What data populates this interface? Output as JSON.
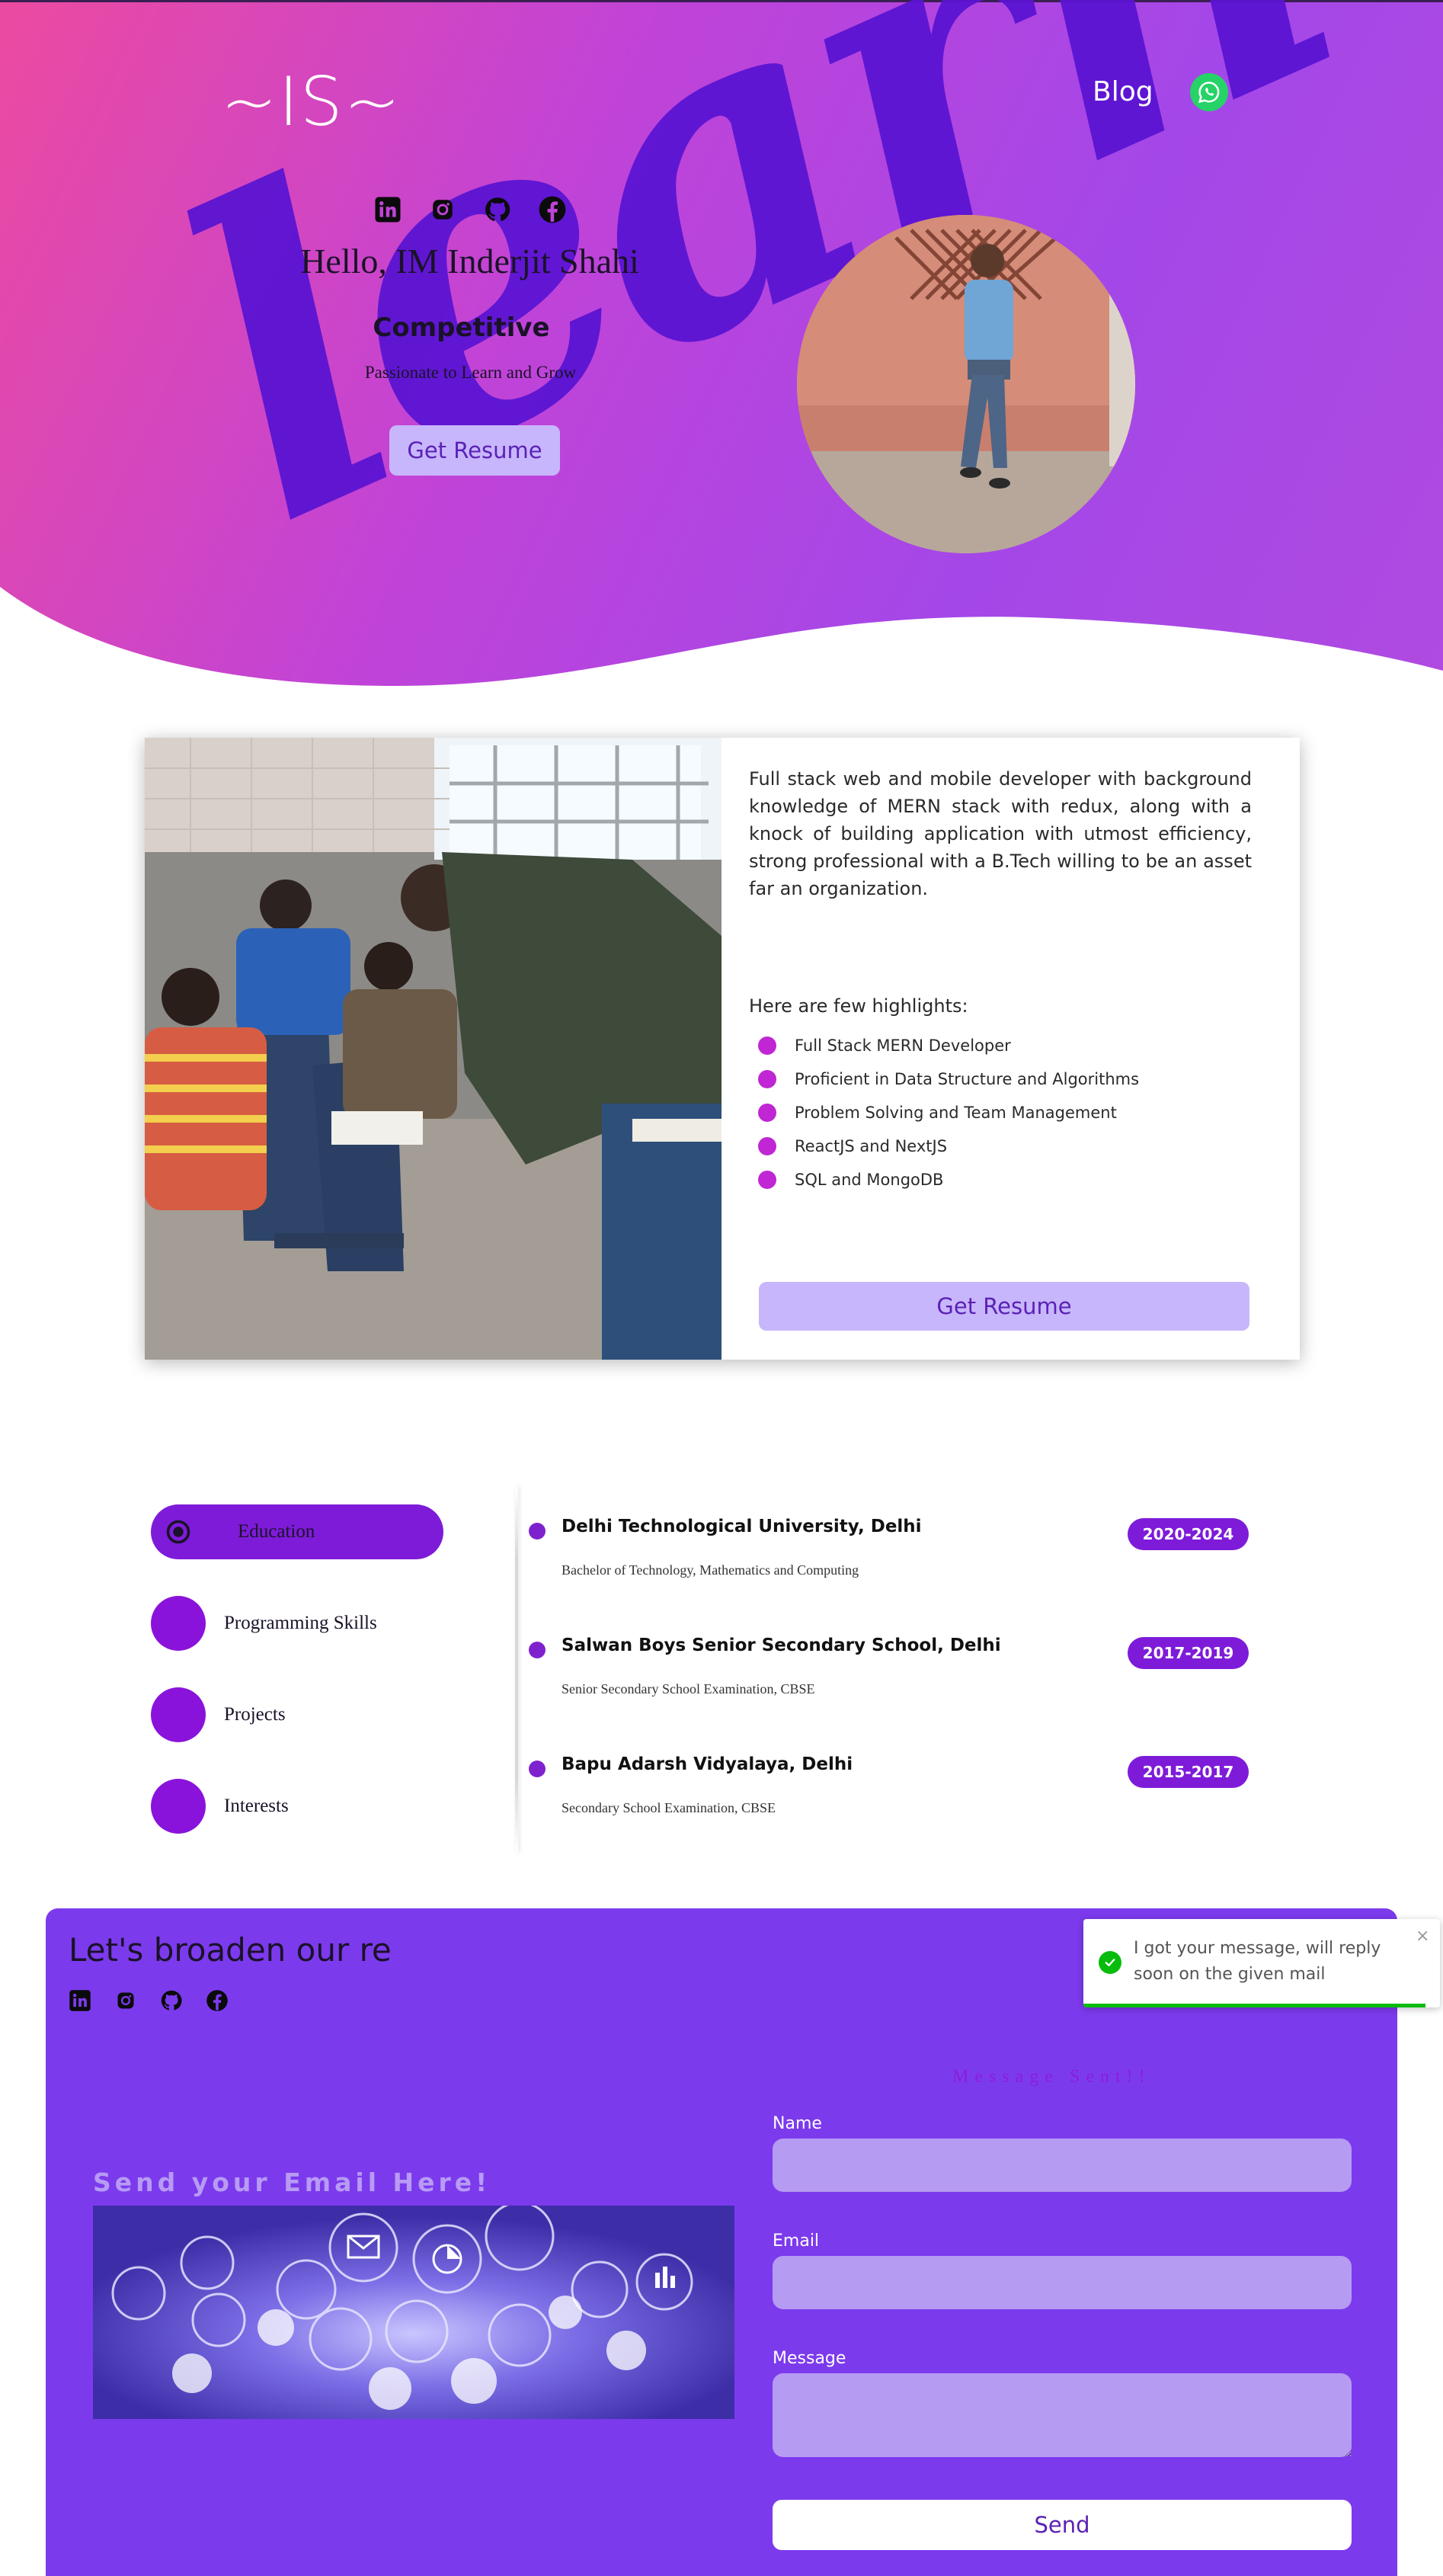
{
  "header": {
    "logo": "~IS~",
    "nav_blog": "Blog",
    "whatsapp_icon": "whatsapp-icon"
  },
  "hero": {
    "social_icons": [
      "linkedin-icon",
      "instagram-icon",
      "github-icon",
      "facebook-icon"
    ],
    "greeting": "Hello, IM Inderjit Shahi",
    "role": "Competitive",
    "tagline": "Passionate to Learn and Grow",
    "resume_button": "Get Resume"
  },
  "about": {
    "description": "Full stack web and mobile developer with background knowledge of MERN stack with redux, along with a knock of building application with utmost efficiency, strong professional with a B.Tech willing to be an asset far an organization.",
    "highlights_title": "Here are few highlights:",
    "highlights": [
      "Full Stack MERN Developer",
      "Proficient in Data Structure and Algorithms",
      "Problem Solving and Team Management",
      "ReactJS and NextJS",
      "SQL and MongoDB"
    ],
    "resume_button": "Get Resume"
  },
  "tabs": [
    {
      "label": "Education",
      "active": true
    },
    {
      "label": "Programming Skills",
      "active": false
    },
    {
      "label": "Projects",
      "active": false
    },
    {
      "label": "Interests",
      "active": false
    }
  ],
  "education": [
    {
      "title": "Delhi Technological University, Delhi",
      "subtitle": "Bachelor of Technology, Mathematics and Computing",
      "years": "2020-2024"
    },
    {
      "title": "Salwan Boys Senior Secondary School, Delhi",
      "subtitle": "Senior Secondary School Examination, CBSE",
      "years": "2017-2019"
    },
    {
      "title": "Bapu Adarsh Vidyalaya, Delhi",
      "subtitle": "Secondary School Examination, CBSE",
      "years": "2015-2017"
    }
  ],
  "contact": {
    "title": "Let's broaden our re",
    "social_icons": [
      "linkedin-icon",
      "instagram-icon",
      "github-icon",
      "facebook-icon"
    ],
    "sent_message": "Message Sent!!",
    "image_heading": "Send your Email Here!",
    "name_label": "Name",
    "email_label": "Email",
    "message_label": "Message",
    "send_button": "Send"
  },
  "toast": {
    "text": "I got your message, will reply soon on the given mail",
    "close": "×",
    "progress": 0.96
  },
  "colors": {
    "accent": "#7c3aed",
    "button_light": "#c7b6fb",
    "bullet": "#c026d3",
    "year_badge": "#7e1bd9",
    "whatsapp": "#25d366",
    "toast_success": "#07bc0c"
  }
}
